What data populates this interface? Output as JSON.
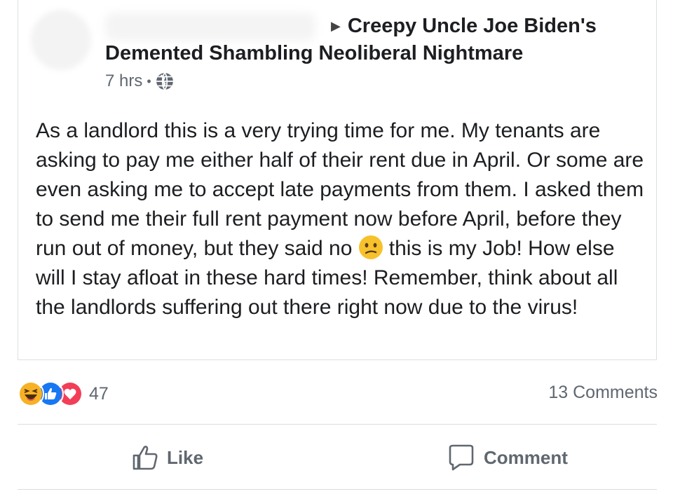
{
  "post": {
    "group_name": "Creepy Uncle Joe Biden's Demented Shambling Neoliberal Nightmare",
    "time": "7 hrs",
    "separator": "•",
    "privacy_icon": "globe-icon",
    "text_before_emoji": "As a landlord this is a very trying time for me. My tenants are asking to pay me either half of their rent due in April. Or some are even asking me to accept late payments from them. I asked them to send me their full rent payment now before April, before they run out of money, but they said no",
    "emoji": "confused-face-icon",
    "text_after_emoji": "this is my Job! How else will I stay afloat in these hard times! Remember, think about all the landlords suffering out there right now due to the virus!"
  },
  "reactions": {
    "icons": [
      "haha-icon",
      "like-icon",
      "love-icon"
    ],
    "count": "47"
  },
  "comments_count": "13 Comments",
  "actions": {
    "like_label": "Like",
    "comment_label": "Comment"
  },
  "colors": {
    "text": "#1c1e21",
    "meta": "#606770",
    "like_blue": "#1877f2",
    "love_red": "#f33e58",
    "haha_yellow": "#f7b125"
  }
}
